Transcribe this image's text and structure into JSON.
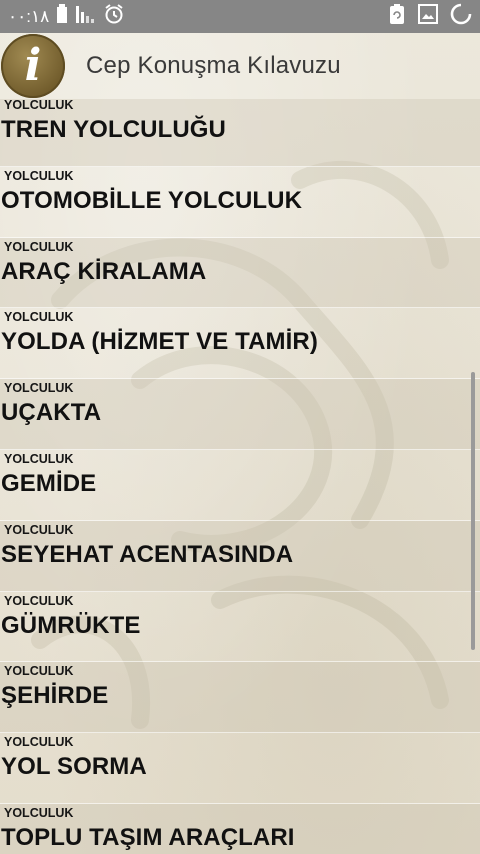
{
  "status_bar": {
    "time": "۰۰:۱۸",
    "icons": [
      "battery-icon",
      "signal-icon",
      "alarm-icon",
      "sync-icon",
      "image-icon",
      "loading-icon"
    ]
  },
  "app_bar": {
    "logo_icon": "info-icon",
    "logo_glyph": "i",
    "title": "Cep Konuşma Kılavuzu"
  },
  "list": {
    "items": [
      {
        "category": "YOLCULUK",
        "title": "TREN YOLCULUĞU"
      },
      {
        "category": "YOLCULUK",
        "title": "OTOMOBİLLE YOLCULUK"
      },
      {
        "category": "YOLCULUK",
        "title": "ARAÇ KİRALAMA"
      },
      {
        "category": "YOLCULUK",
        "title": "YOLDA (HİZMET VE TAMİR)"
      },
      {
        "category": "YOLCULUK",
        "title": "UÇAKTA"
      },
      {
        "category": "YOLCULUK",
        "title": "GEMİDE"
      },
      {
        "category": "YOLCULUK",
        "title": "SEYEHAT ACENTASINDA"
      },
      {
        "category": "YOLCULUK",
        "title": "GÜMRÜKTE"
      },
      {
        "category": "YOLCULUK",
        "title": "ŞEHİRDE"
      },
      {
        "category": "YOLCULUK",
        "title": "YOL SORMA"
      },
      {
        "category": "YOLCULUK",
        "title": "TOPLU TAŞIM ARAÇLARI"
      }
    ]
  },
  "colors": {
    "status_bar_bg": "#868686",
    "logo_bg": "#7d6a38",
    "text_primary": "#111111"
  }
}
